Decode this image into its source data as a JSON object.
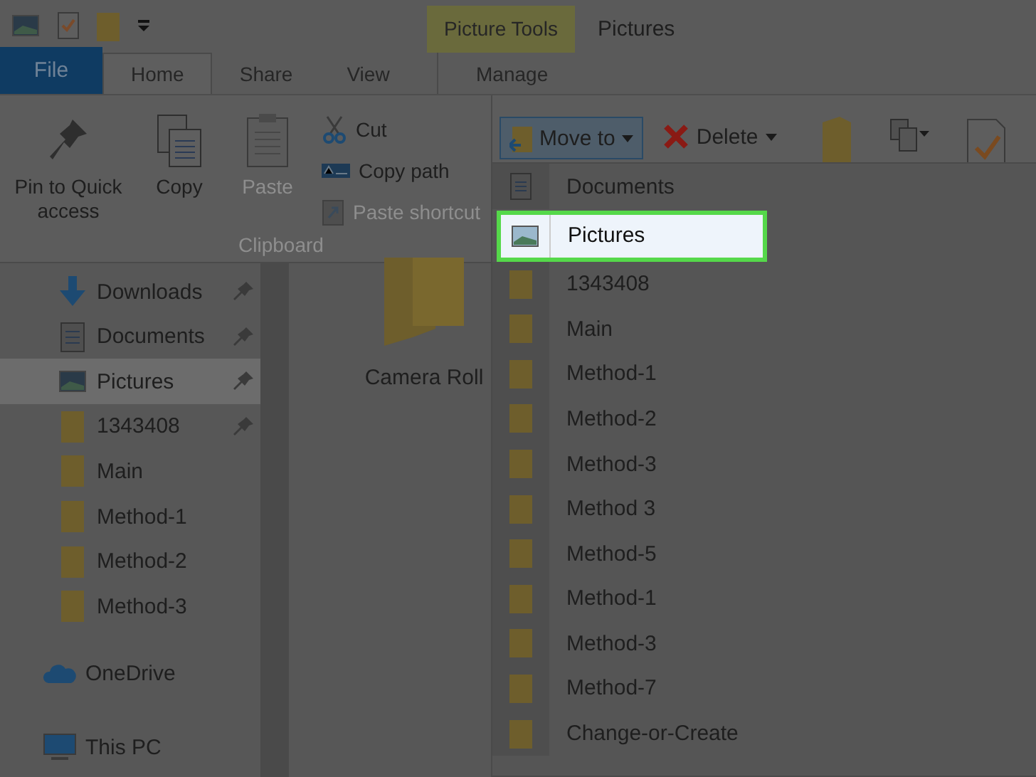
{
  "contextual_tab_group": "Picture Tools",
  "window_title": "Pictures",
  "ribbon_tabs": [
    {
      "label": "File",
      "kind": "file",
      "selected": false
    },
    {
      "label": "Home",
      "kind": "tab",
      "selected": true
    },
    {
      "label": "Share",
      "kind": "tab",
      "selected": false
    },
    {
      "label": "View",
      "kind": "tab",
      "selected": false
    },
    {
      "label": "Manage",
      "kind": "contextual",
      "selected": false
    }
  ],
  "clipboard_group": {
    "label": "Clipboard",
    "large_buttons": [
      {
        "label": "Pin to Quick access",
        "kind": "pin",
        "disabled": false
      },
      {
        "label": "Copy",
        "kind": "copy",
        "disabled": false
      },
      {
        "label": "Paste",
        "kind": "paste",
        "disabled": true
      }
    ],
    "small_buttons": [
      {
        "label": "Cut",
        "kind": "cut",
        "disabled": false
      },
      {
        "label": "Copy path",
        "kind": "path",
        "disabled": false
      },
      {
        "label": "Paste shortcut",
        "kind": "shortcut",
        "disabled": true
      }
    ]
  },
  "organize_buttons": [
    {
      "label": "Move to",
      "kind": "move",
      "selected": true
    },
    {
      "label": "Delete",
      "kind": "delete",
      "selected": false
    }
  ],
  "navigation_pane": {
    "quick_access": [
      {
        "label": "Downloads",
        "kind": "downloads",
        "pinned": true,
        "selected": false
      },
      {
        "label": "Documents",
        "kind": "documents",
        "pinned": true,
        "selected": false
      },
      {
        "label": "Pictures",
        "kind": "pictures",
        "pinned": true,
        "selected": true
      },
      {
        "label": "1343408",
        "kind": "folder",
        "pinned": true,
        "selected": false
      },
      {
        "label": "Main",
        "kind": "folder",
        "pinned": false,
        "selected": false
      },
      {
        "label": "Method-1",
        "kind": "folder",
        "pinned": false,
        "selected": false
      },
      {
        "label": "Method-2",
        "kind": "folder",
        "pinned": false,
        "selected": false
      },
      {
        "label": "Method-3",
        "kind": "folder",
        "pinned": false,
        "selected": false
      }
    ],
    "locations": [
      {
        "label": "OneDrive",
        "kind": "cloud"
      },
      {
        "label": "This PC",
        "kind": "pc"
      }
    ]
  },
  "files": [
    {
      "label": "Camera Roll"
    }
  ],
  "move_to_menu": [
    {
      "label": "Documents",
      "kind": "documents",
      "selected": false
    },
    {
      "label": "Pictures",
      "kind": "pictures",
      "selected": true
    },
    {
      "label": "1343408",
      "kind": "folder",
      "selected": false
    },
    {
      "label": "Main",
      "kind": "folder",
      "selected": false
    },
    {
      "label": "Method-1",
      "kind": "folder",
      "selected": false
    },
    {
      "label": "Method-2",
      "kind": "folder",
      "selected": false
    },
    {
      "label": "Method-3",
      "kind": "folder",
      "selected": false
    },
    {
      "label": "Method 3",
      "kind": "folder",
      "selected": false
    },
    {
      "label": "Method-5",
      "kind": "folder",
      "selected": false
    },
    {
      "label": "Method-1",
      "kind": "folder",
      "selected": false
    },
    {
      "label": "Method-3",
      "kind": "folder",
      "selected": false
    },
    {
      "label": "Method-7",
      "kind": "folder",
      "selected": false
    },
    {
      "label": "Change-or-Create",
      "kind": "folder",
      "selected": false
    }
  ]
}
